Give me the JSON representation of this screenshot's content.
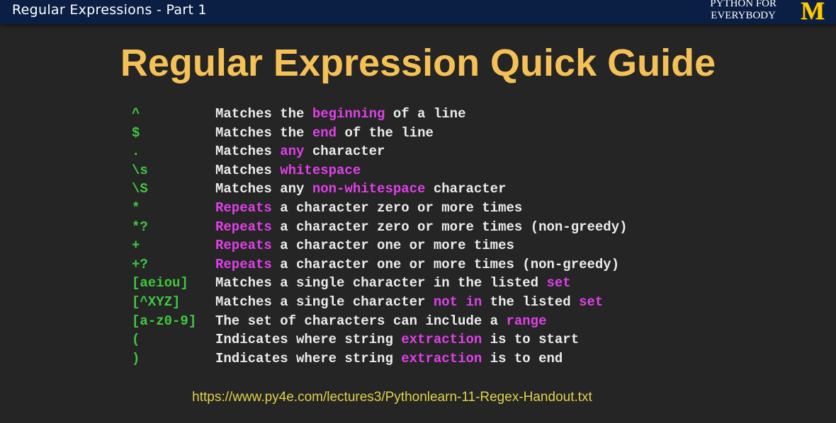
{
  "header": {
    "video_title": "Regular Expressions - Part 1",
    "brand_line1": "PYTHON FOR",
    "brand_line2": "EVERYBODY",
    "logo_text": "M"
  },
  "slide": {
    "title": "Regular Expression Quick Guide",
    "rows": [
      {
        "symbol": "^",
        "parts": [
          [
            "Matches the ",
            "w"
          ],
          [
            "beginning",
            "m"
          ],
          [
            " of a line",
            "w"
          ]
        ]
      },
      {
        "symbol": "$",
        "parts": [
          [
            "Matches the ",
            "w"
          ],
          [
            "end",
            "m"
          ],
          [
            " of the line",
            "w"
          ]
        ]
      },
      {
        "symbol": ".",
        "parts": [
          [
            "Matches ",
            "w"
          ],
          [
            "any",
            "m"
          ],
          [
            " character",
            "w"
          ]
        ]
      },
      {
        "symbol": "\\s",
        "parts": [
          [
            "Matches ",
            "w"
          ],
          [
            "whitespace",
            "m"
          ]
        ]
      },
      {
        "symbol": "\\S",
        "parts": [
          [
            "Matches any ",
            "w"
          ],
          [
            "non-whitespace",
            "m"
          ],
          [
            " character",
            "w"
          ]
        ]
      },
      {
        "symbol": "*",
        "parts": [
          [
            "Repeats",
            "m"
          ],
          [
            " a character zero or more times",
            "w"
          ]
        ]
      },
      {
        "symbol": "*?",
        "parts": [
          [
            "Repeats",
            "m"
          ],
          [
            " a character zero or more times (non-greedy)",
            "w"
          ]
        ]
      },
      {
        "symbol": "+",
        "parts": [
          [
            "Repeats",
            "m"
          ],
          [
            " a character one or more times",
            "w"
          ]
        ]
      },
      {
        "symbol": "+?",
        "parts": [
          [
            "Repeats",
            "m"
          ],
          [
            " a character one or more times (non-greedy)",
            "w"
          ]
        ]
      },
      {
        "symbol": "[aeiou]",
        "parts": [
          [
            "Matches a single character in the listed ",
            "w"
          ],
          [
            "set",
            "m"
          ]
        ]
      },
      {
        "symbol": "[^XYZ]",
        "parts": [
          [
            "Matches a single character ",
            "w"
          ],
          [
            "not in",
            "m"
          ],
          [
            " the listed ",
            "w"
          ],
          [
            "set",
            "m"
          ]
        ]
      },
      {
        "symbol": "[a-z0-9]",
        "parts": [
          [
            "The set of characters can include a ",
            "w"
          ],
          [
            "range",
            "m"
          ]
        ]
      },
      {
        "symbol": "(",
        "parts": [
          [
            "Indicates where string ",
            "w"
          ],
          [
            "extraction",
            "m"
          ],
          [
            " is to start",
            "w"
          ]
        ]
      },
      {
        "symbol": ")",
        "parts": [
          [
            "Indicates where string ",
            "w"
          ],
          [
            "extraction",
            "m"
          ],
          [
            " is to end",
            "w"
          ]
        ]
      }
    ],
    "url": "https://www.py4e.com/lectures3/Pythonlearn-11-Regex-Handout.txt"
  },
  "colors": {
    "title": "#f5c156",
    "symbol": "#3ec93e",
    "text": "#ececec",
    "highlight": "#e040e8",
    "url": "#e2d14a",
    "header_bg": "#0b1f45",
    "logo": "#ffcb05"
  }
}
